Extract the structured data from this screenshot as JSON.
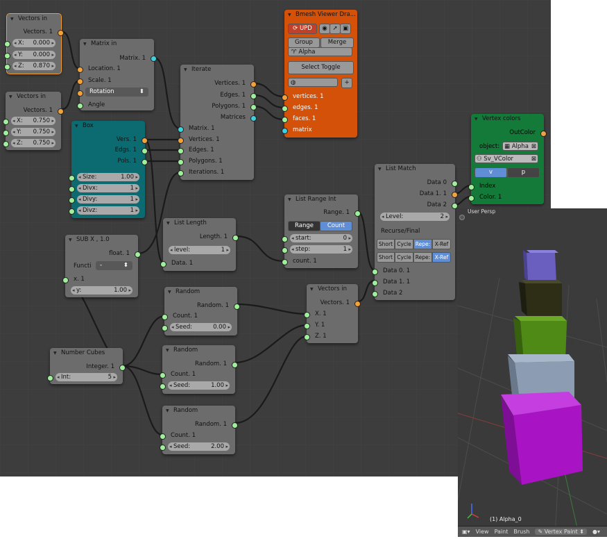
{
  "nodes": {
    "vectors_in_1": {
      "title": "Vectors in",
      "out": "Vectors. 1",
      "fields": [
        {
          "label": "X:",
          "value": "0.000"
        },
        {
          "label": "Y:",
          "value": "0.000"
        },
        {
          "label": "Z:",
          "value": "0.870"
        }
      ]
    },
    "vectors_in_2": {
      "title": "Vectors in",
      "out": "Vectors. 1",
      "fields": [
        {
          "label": "X:",
          "value": "0.750"
        },
        {
          "label": "Y:",
          "value": "0.750"
        },
        {
          "label": "Z:",
          "value": "0.750"
        }
      ]
    },
    "matrix_in": {
      "title": "Matrix in",
      "out": "Matrix. 1",
      "inputs": [
        "Location. 1",
        "Scale. 1"
      ],
      "rotation": "Rotation",
      "angle": "Angle"
    },
    "box": {
      "title": "Box",
      "outs": [
        "Vers. 1",
        "Edgs. 1",
        "Pols. 1"
      ],
      "fields": [
        {
          "label": "Size:",
          "value": "1.00"
        },
        {
          "label": "Divx:",
          "value": "1"
        },
        {
          "label": "Divy:",
          "value": "1"
        },
        {
          "label": "Divz:",
          "value": "1"
        }
      ]
    },
    "iterate": {
      "title": "Iterate",
      "outs": [
        "Vertices. 1",
        "Edges. 1",
        "Polygons. 1",
        "Matrices"
      ],
      "inputs": [
        "Matrix. 1",
        "Vertices. 1",
        "Edges. 1",
        "Polygons. 1",
        "Iterations. 1"
      ]
    },
    "bmesh": {
      "title": "Bmesh Viewer Dra...",
      "upd": "UPD",
      "group": "Group",
      "merge": "Merge",
      "alpha": "Alpha",
      "select_toggle": "Select Toggle",
      "inputs": [
        "vertices. 1",
        "edges. 1",
        "faces. 1",
        "matrix"
      ]
    },
    "vertex_colors": {
      "title": "Vertex colors",
      "out": "OutColor",
      "object_label": "object:",
      "object_value": "Alpha",
      "vcolor": "Sv_VColor",
      "v": "v",
      "p": "p",
      "inputs": [
        "Index",
        "Color. 1"
      ]
    },
    "list_match": {
      "title": "List Match",
      "outs": [
        "Data 0",
        "Data 1. 1",
        "Data 2"
      ],
      "level_label": "Level:",
      "level_value": "2",
      "recurse": "Recurse/Final",
      "opts": [
        "Short",
        "Cycle",
        "Repe:",
        "X-Ref"
      ],
      "inputs": [
        "Data 0. 1",
        "Data 1. 1",
        "Data 2"
      ]
    },
    "list_range": {
      "title": "List Range Int",
      "out": "Range. 1",
      "mode1": "Range",
      "mode2": "Count",
      "fields": [
        {
          "label": "start:",
          "value": "0"
        },
        {
          "label": "step:",
          "value": "1"
        }
      ],
      "count": "count. 1"
    },
    "list_length": {
      "title": "List Length",
      "out": "Length. 1",
      "level_label": "level:",
      "level_value": "1",
      "data": "Data. 1"
    },
    "sub": {
      "title": "SUB X , 1.0",
      "out": "float. 1",
      "func_label": "Functi",
      "func_value": "-",
      "x": "x. 1",
      "y_label": "y:",
      "y_value": "1.00"
    },
    "random1": {
      "title": "Random",
      "out": "Random. 1",
      "count": "Count. 1",
      "seed_label": "Seed:",
      "seed_value": "0.00"
    },
    "random2": {
      "title": "Random",
      "out": "Random. 1",
      "count": "Count. 1",
      "seed_label": "Seed:",
      "seed_value": "1.00"
    },
    "random3": {
      "title": "Random",
      "out": "Random. 1",
      "count": "Count. 1",
      "seed_label": "Seed:",
      "seed_value": "2.00"
    },
    "vectors_in_3": {
      "title": "Vectors in",
      "out": "Vectors. 1",
      "inputs": [
        "X. 1",
        "Y. 1",
        "Z. 1"
      ]
    },
    "number_cubes": {
      "title": "Number Cubes",
      "out": "Integer. 1",
      "int_label": "Int:",
      "int_value": "5"
    }
  },
  "viewport": {
    "header": "User Persp",
    "object_label": "(1) Alpha_0",
    "menu": [
      "View",
      "Paint",
      "Brush"
    ],
    "mode": "Vertex Paint",
    "cube_colors": [
      "#6a5fbf",
      "#2e2e16",
      "#4f8a16",
      "#8c9cb2",
      "#a814c4"
    ]
  }
}
